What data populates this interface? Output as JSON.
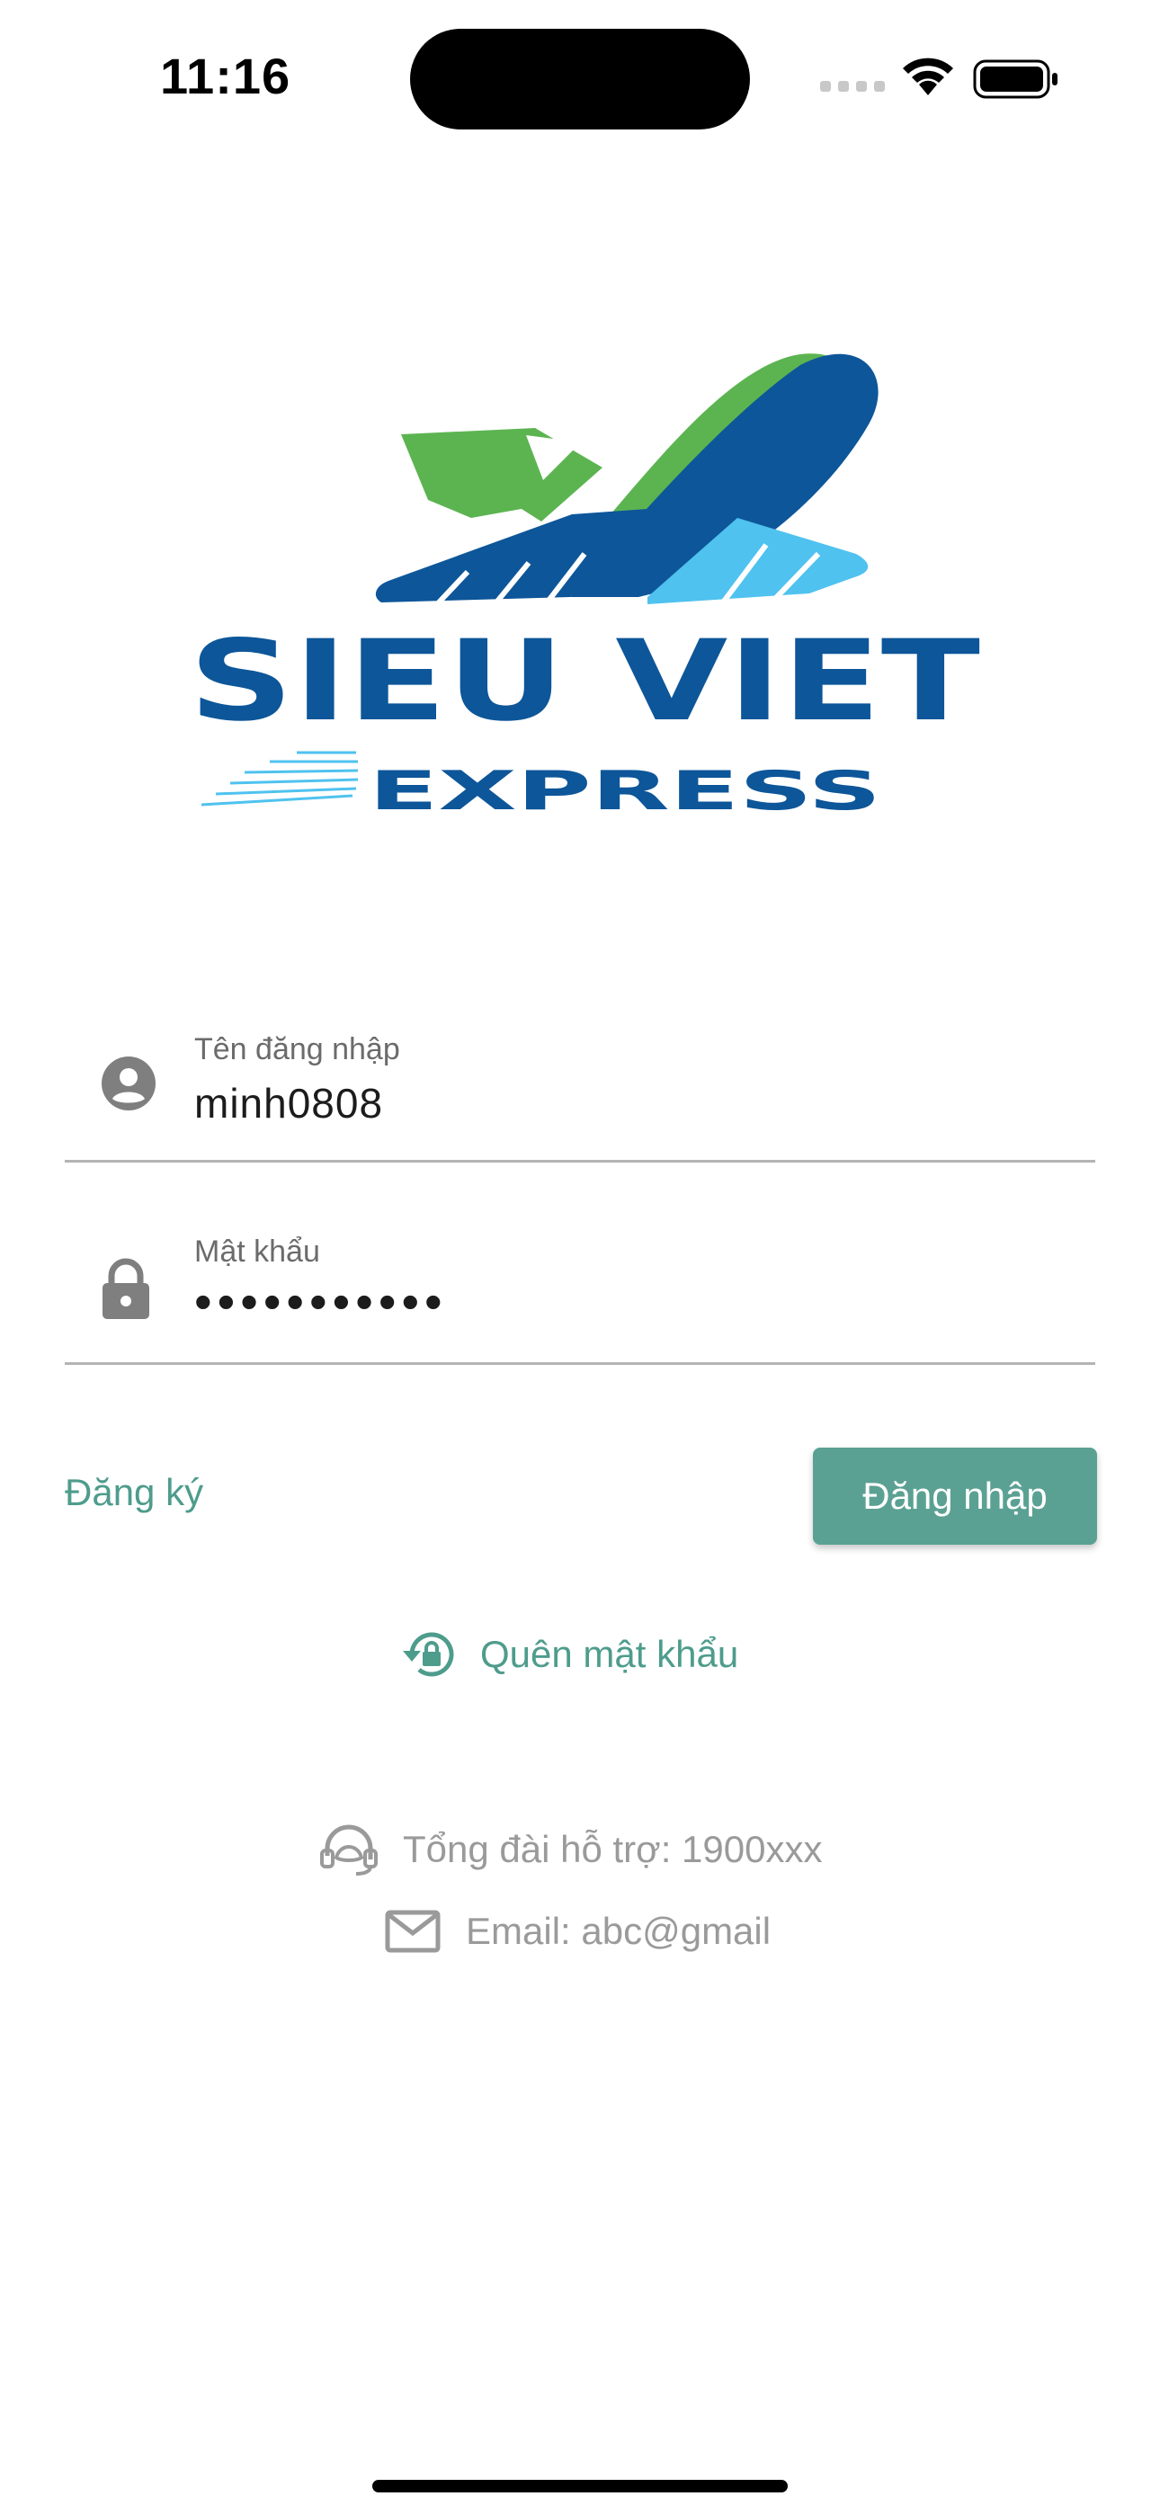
{
  "status_bar": {
    "time": "11:16"
  },
  "logo": {
    "brand": "SIEU VIET",
    "tagline": "EXPRESS"
  },
  "form": {
    "username": {
      "label": "Tên đăng nhập",
      "value": "minh0808",
      "icon": "account-circle-icon"
    },
    "password": {
      "label": "Mật khẩu",
      "value": "•••••••••••",
      "icon": "lock-icon"
    }
  },
  "actions": {
    "register_label": "Đăng ký",
    "login_label": "Đăng nhập",
    "forgot_label": "Quên mật khẩu"
  },
  "support": {
    "hotline_text": "Tổng đài hỗ trợ: 1900xxx",
    "email_text": "Email: abc@gmail"
  },
  "colors": {
    "accent": "#5ba193",
    "accent_text": "#4e9c8c",
    "logo_blue": "#0d5699",
    "logo_green": "#5cb451",
    "logo_light_blue": "#4fc2ef"
  }
}
